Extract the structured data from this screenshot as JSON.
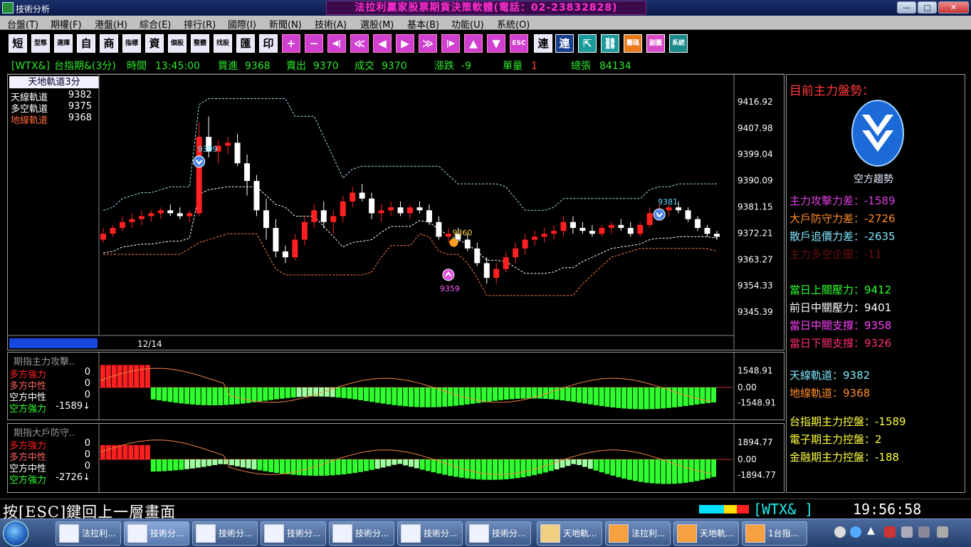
{
  "window": {
    "title": "技術分析",
    "ad_banner": "法拉利贏家股票期貨決策軟體(電話：02-23832828)",
    "min_label": "—",
    "max_label": "□",
    "close_label": "✕"
  },
  "menu": [
    "台盤(T)",
    "期權(F)",
    "港盤(H)",
    "綜合(E)",
    "排行(R)",
    "國際(I)",
    "新聞(N)",
    "技術(A)",
    "選股(M)",
    "基本(B)",
    "功能(U)",
    "系統(O)"
  ],
  "toolbar": {
    "text_buttons": [
      "短",
      "型態",
      "選擇",
      "自",
      "商",
      "指標",
      "資",
      "個股",
      "整體",
      "找股",
      "匯",
      "印"
    ],
    "nav_buttons": [
      "+",
      "−",
      "◀|",
      "≪",
      "◀",
      "▶",
      "≫",
      "|▶",
      "▲",
      "▼",
      "ESC"
    ],
    "right_buttons": [
      "連",
      "連",
      "⇱",
      "⛓",
      "籌碼",
      "副圖",
      "系統"
    ]
  },
  "quote": {
    "symbol": "[WTX&]",
    "name": "台指期&(3分)",
    "time_label": "時間",
    "time": "13:45:00",
    "bid_label": "買進",
    "bid": "9368",
    "ask_label": "賣出",
    "ask": "9370",
    "deal_label": "成交",
    "deal": "9370",
    "change_label": "漲跌",
    "change": "-9",
    "vol_label": "單量",
    "vol": "1",
    "total_label": "總張",
    "total": "84134"
  },
  "main_legend": {
    "title": "天地軌道3分",
    "items": [
      {
        "label": "天線軌道",
        "value": "9382",
        "color": "#ffffff"
      },
      {
        "label": "多空軌道",
        "value": "9375",
        "color": "#ffffff"
      },
      {
        "label": "地線軌道",
        "value": "9368",
        "color": "#ff6a3d"
      }
    ]
  },
  "chart_data": [
    {
      "type": "candlestick",
      "title": "天地軌道3分",
      "y_ticks": [
        "9416.92",
        "9407.98",
        "9399.04",
        "9390.09",
        "9381.15",
        "9372.21",
        "9363.27",
        "9354.33",
        "9345.39"
      ],
      "ylim": [
        9340,
        9420
      ],
      "x_label": "12/14",
      "annotations": [
        {
          "text": "9399",
          "value": 9399,
          "kind": "sell-signal",
          "color": "#5fdcff"
        },
        {
          "text": "9381",
          "value": 9381,
          "kind": "sell-signal",
          "color": "#5fdcff"
        },
        {
          "text": "9360",
          "value": 9369,
          "kind": "marker",
          "color": "#ffd040"
        },
        {
          "text": "9359",
          "value": 9359,
          "kind": "buy-signal",
          "color": "#ff5cff"
        }
      ],
      "series": [
        {
          "name": "天線軌道",
          "color": "#9ee0ee",
          "style": "dashed"
        },
        {
          "name": "多空軌道",
          "color": "#ffffff",
          "style": "dashed"
        },
        {
          "name": "地線軌道",
          "color": "#ff8040",
          "style": "dashed"
        }
      ],
      "candles": [
        [
          9370,
          9374,
          9369,
          9372
        ],
        [
          9372,
          9375,
          9371,
          9374
        ],
        [
          9374,
          9378,
          9373,
          9376
        ],
        [
          9376,
          9379,
          9374,
          9377
        ],
        [
          9377,
          9380,
          9375,
          9378
        ],
        [
          9378,
          9380,
          9376,
          9379
        ],
        [
          9379,
          9381,
          9377,
          9380
        ],
        [
          9380,
          9382,
          9378,
          9379
        ],
        [
          9379,
          9381,
          9377,
          9378
        ],
        [
          9378,
          9380,
          9376,
          9379
        ],
        [
          9379,
          9410,
          9378,
          9405
        ],
        [
          9405,
          9412,
          9398,
          9400
        ],
        [
          9400,
          9404,
          9396,
          9402
        ],
        [
          9402,
          9405,
          9399,
          9403
        ],
        [
          9403,
          9406,
          9395,
          9396
        ],
        [
          9396,
          9399,
          9385,
          9390
        ],
        [
          9390,
          9392,
          9378,
          9380
        ],
        [
          9380,
          9384,
          9370,
          9374
        ],
        [
          9374,
          9377,
          9364,
          9366
        ],
        [
          9366,
          9368,
          9362,
          9364
        ],
        [
          9364,
          9372,
          9363,
          9370
        ],
        [
          9370,
          9378,
          9368,
          9376
        ],
        [
          9376,
          9382,
          9374,
          9380
        ],
        [
          9380,
          9383,
          9374,
          9376
        ],
        [
          9376,
          9380,
          9372,
          9378
        ],
        [
          9378,
          9385,
          9376,
          9383
        ],
        [
          9383,
          9388,
          9381,
          9386
        ],
        [
          9386,
          9389,
          9383,
          9384
        ],
        [
          9384,
          9386,
          9377,
          9379
        ],
        [
          9379,
          9382,
          9376,
          9380
        ],
        [
          9380,
          9383,
          9378,
          9381
        ],
        [
          9381,
          9383,
          9378,
          9379
        ],
        [
          9379,
          9382,
          9377,
          9381
        ],
        [
          9381,
          9383,
          9379,
          9380
        ],
        [
          9380,
          9382,
          9375,
          9376
        ],
        [
          9376,
          9378,
          9370,
          9371
        ],
        [
          9371,
          9374,
          9369,
          9372
        ],
        [
          9372,
          9374,
          9369,
          9370
        ],
        [
          9370,
          9372,
          9366,
          9367
        ],
        [
          9367,
          9369,
          9361,
          9362
        ],
        [
          9362,
          9364,
          9355,
          9357
        ],
        [
          9357,
          9362,
          9355,
          9360
        ],
        [
          9360,
          9366,
          9359,
          9364
        ],
        [
          9364,
          9369,
          9362,
          9367
        ],
        [
          9367,
          9372,
          9365,
          9370
        ],
        [
          9370,
          9373,
          9368,
          9371
        ],
        [
          9371,
          9374,
          9369,
          9372
        ],
        [
          9372,
          9375,
          9370,
          9373
        ],
        [
          9373,
          9378,
          9371,
          9376
        ],
        [
          9376,
          9378,
          9372,
          9374
        ],
        [
          9374,
          9376,
          9372,
          9373
        ],
        [
          9373,
          9375,
          9371,
          9372
        ],
        [
          9372,
          9375,
          9371,
          9374
        ],
        [
          9374,
          9376,
          9372,
          9375
        ],
        [
          9375,
          9377,
          9373,
          9374
        ],
        [
          9374,
          9376,
          9371,
          9372
        ],
        [
          9372,
          9376,
          9371,
          9375
        ],
        [
          9375,
          9381,
          9374,
          9379
        ],
        [
          9379,
          9382,
          9377,
          9380
        ],
        [
          9380,
          9382,
          9378,
          9381
        ],
        [
          9381,
          9383,
          9379,
          9380
        ],
        [
          9380,
          9381,
          9376,
          9377
        ],
        [
          9377,
          9378,
          9373,
          9374
        ],
        [
          9374,
          9375,
          9371,
          9372
        ],
        [
          9372,
          9373,
          9370,
          9371
        ]
      ]
    },
    {
      "type": "bar",
      "title": "期指主力攻擊..",
      "y_ticks": [
        "1548.91",
        "0.00",
        "-1548.91"
      ],
      "ylim": [
        -1548.91,
        1548.91
      ],
      "legend": [
        {
          "label": "多方強力",
          "value": "0",
          "color": "#ff2020"
        },
        {
          "label": "多方中性",
          "value": "0",
          "color": "#ff6060"
        },
        {
          "label": "空方中性",
          "value": "0",
          "color": "#ffffff"
        },
        {
          "label": "空方強力",
          "value": "-1589↓",
          "color": "#30ff30"
        }
      ]
    },
    {
      "type": "bar",
      "title": "期指大戶防守..",
      "y_ticks": [
        "1894.77",
        "0.00",
        "-1894.77"
      ],
      "ylim": [
        -1894.77,
        1894.77
      ],
      "legend": [
        {
          "label": "多方強力",
          "value": "0",
          "color": "#ff2020"
        },
        {
          "label": "多方中性",
          "value": "0",
          "color": "#ff6060"
        },
        {
          "label": "空方中性",
          "value": "0",
          "color": "#ffffff"
        },
        {
          "label": "空方強力",
          "value": "-2726↓",
          "color": "#30ff30"
        }
      ]
    }
  ],
  "right_panel": {
    "heading": "目前主力盤勢：",
    "trend_label": "空方趨勢",
    "stats": [
      {
        "label": "主力攻擊力差：",
        "value": "-1589",
        "color": "#e040e0"
      },
      {
        "label": "大戶防守力差：",
        "value": "-2726",
        "color": "#ff8c2a"
      },
      {
        "label": "散戶追價力差：",
        "value": "-2635",
        "color": "#7fe8ff"
      },
      {
        "label": "主力多空企圖：",
        "value": "-11",
        "color": "#6a1010"
      }
    ],
    "levels": [
      {
        "label": "當日上關壓力：",
        "value": "9412",
        "color": "#30ff30"
      },
      {
        "label": "前日中關壓力：",
        "value": "9401",
        "color": "#ffffff"
      },
      {
        "label": "當日中關支撐：",
        "value": "9358",
        "color": "#ff40ff"
      },
      {
        "label": "當日下關支撐：",
        "value": "9326",
        "color": "#ff3070"
      }
    ],
    "tracks": [
      {
        "label": "天線軌道：",
        "value": "9382",
        "color": "#7fe8ff"
      },
      {
        "label": "地線軌道：",
        "value": "9368",
        "color": "#ff8c2a"
      }
    ],
    "control": [
      {
        "label": "台指期主力控盤：",
        "value": "-1589",
        "color": "#ffff40"
      },
      {
        "label": "電子期主力控盤：",
        "value": "2",
        "color": "#ffff40"
      },
      {
        "label": "金融期主力控盤：",
        "value": "-188",
        "color": "#ffff40"
      }
    ]
  },
  "status": {
    "message": "按[ESC]鍵回上一層畫面",
    "symbol": "[WTX&   ]",
    "time": "19:56:58",
    "swatches": [
      "#00e0ff",
      "#00e0ff",
      "#ffe000",
      "#ff2020"
    ]
  },
  "taskbar": {
    "items": [
      "法拉利...",
      "技術分...",
      "技術分...",
      "技術分...",
      "技術分...",
      "技術分...",
      "技術分...",
      "天地軌...",
      "法拉利...",
      "天地軌...",
      "1台指..."
    ]
  }
}
